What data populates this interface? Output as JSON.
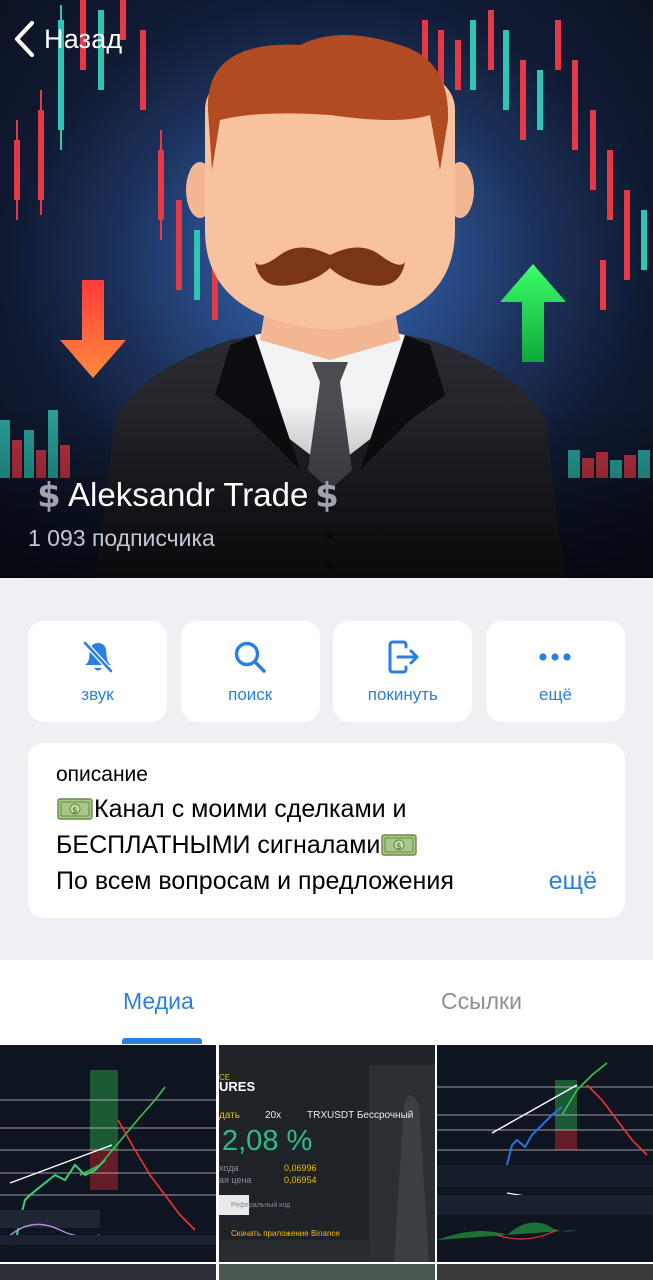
{
  "header": {
    "back_label": "Назад",
    "channel_name": "Aleksandr Trade",
    "subscribers": "1 093 подписчика"
  },
  "actions": [
    {
      "label": "звук",
      "icon": "bell-off-icon"
    },
    {
      "label": "поиск",
      "icon": "search-icon"
    },
    {
      "label": "покинуть",
      "icon": "leave-icon"
    },
    {
      "label": "ещё",
      "icon": "more-icon"
    }
  ],
  "description": {
    "heading": "описание",
    "line1": "Канал с моими сделками и",
    "line2": "БЕСПЛАТНЫМИ сигналами",
    "line3": "По всем вопросам и предложения",
    "more_label": "ещё"
  },
  "tabs": {
    "media": "Медиа",
    "links": "Ссылки"
  },
  "media": {
    "tile2": {
      "brand_top": "CE",
      "brand": "URES",
      "tab_label": "дать",
      "leverage": "20x",
      "pair": "TRXUSDT Бессрочный",
      "pnl": "2,08 %",
      "entry_label": "хода",
      "entry_value": "0,06996",
      "mark_label": "ая цена",
      "mark_value": "0,06954",
      "ref_label": "Реферальный код",
      "download": "Скачать приложение Binance"
    }
  },
  "colors": {
    "accent": "#2b7fe0",
    "background": "#efeff4",
    "card": "#ffffff",
    "pnl_green": "#2ebd85",
    "binance_yellow": "#f0b90b"
  }
}
